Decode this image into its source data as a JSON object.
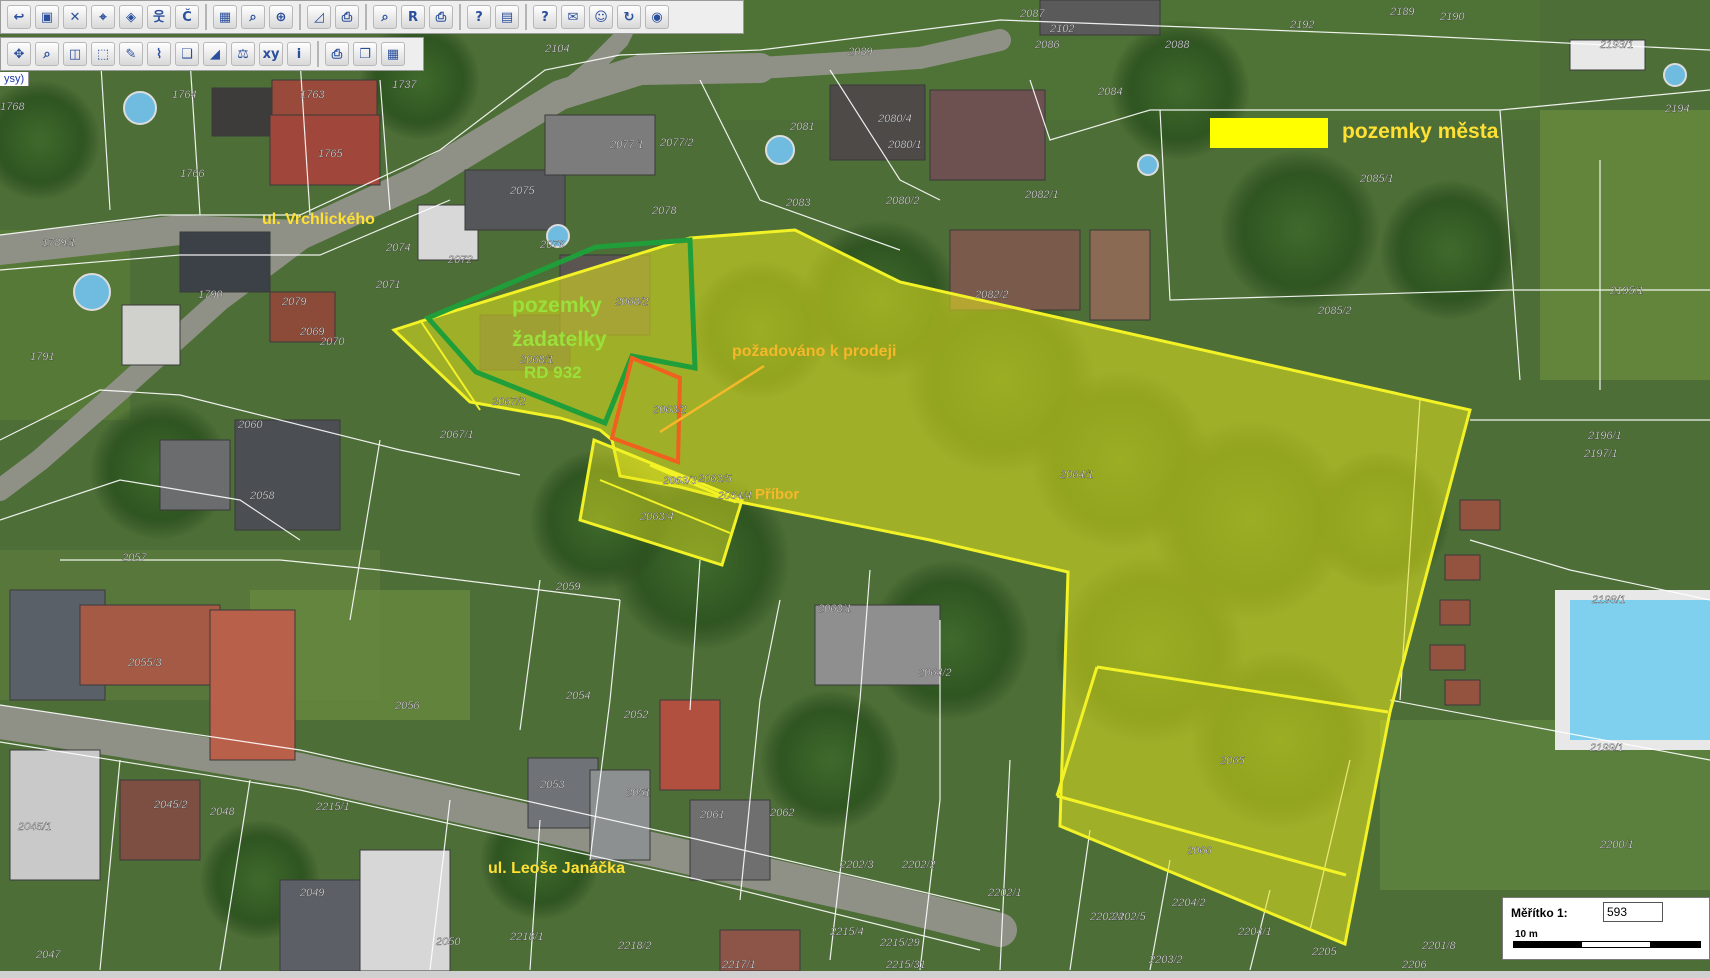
{
  "toolbar_top": [
    {
      "icon": "back-icon",
      "glyph": "↩"
    },
    {
      "icon": "save-icon",
      "glyph": "▣"
    },
    {
      "icon": "delete-map-icon",
      "glyph": "✕"
    },
    {
      "icon": "identify-icon",
      "glyph": "⌖"
    },
    {
      "icon": "pin-icon",
      "glyph": "◈"
    },
    {
      "icon": "person-icon",
      "glyph": "웃"
    },
    {
      "icon": "cadastral-number-icon",
      "glyph": "Č"
    },
    {
      "icon": "parcel-info-icon",
      "glyph": "▦"
    },
    {
      "icon": "zoom-icon",
      "glyph": "⌕"
    },
    {
      "icon": "zoom-plus-icon",
      "glyph": "⊕"
    },
    {
      "icon": "measure-icon",
      "glyph": "◿"
    },
    {
      "icon": "print-icon",
      "glyph": "⎙"
    },
    {
      "icon": "search-icon",
      "glyph": "⌕"
    },
    {
      "icon": "rvo-icon",
      "glyph": "R"
    },
    {
      "icon": "printer-icon",
      "glyph": "⎙"
    },
    {
      "icon": "report-icon",
      "glyph": "?"
    },
    {
      "icon": "document-icon",
      "glyph": "▤"
    },
    {
      "icon": "help-icon",
      "glyph": "?"
    },
    {
      "icon": "mail-icon",
      "glyph": "✉"
    },
    {
      "icon": "user-icon",
      "glyph": "☺"
    },
    {
      "icon": "refresh-icon",
      "glyph": "↻"
    },
    {
      "icon": "globe-icon",
      "glyph": "◉"
    }
  ],
  "toolbar_second": [
    {
      "icon": "navigate-icon",
      "glyph": "✥"
    },
    {
      "icon": "zoom-window-icon",
      "glyph": "⌕"
    },
    {
      "icon": "zoom-select-icon",
      "glyph": "◫"
    },
    {
      "icon": "select-icon",
      "glyph": "⬚"
    },
    {
      "icon": "pencil-icon",
      "glyph": "✎"
    },
    {
      "icon": "edit-node-icon",
      "glyph": "⌇"
    },
    {
      "icon": "layers-icon",
      "glyph": "❑"
    },
    {
      "icon": "eraser-icon",
      "glyph": "◢"
    },
    {
      "icon": "scale-icon",
      "glyph": "⚖"
    },
    {
      "icon": "coordinates-icon",
      "glyph": "xy"
    },
    {
      "icon": "info-icon",
      "glyph": "i"
    },
    {
      "icon": "printer-icon",
      "glyph": "⎙"
    },
    {
      "icon": "copy-icon",
      "glyph": "❐"
    },
    {
      "icon": "legend-icon",
      "glyph": "▦"
    }
  ],
  "layer_tab": "ysy)",
  "legend": {
    "text": "pozemky města",
    "swatch_color": "#ffff00"
  },
  "annotations": {
    "applicant_lots": [
      "pozemky",
      "žadatelky"
    ],
    "house": "RD 932",
    "requested": "požadováno k prodeji",
    "town": "Příbor",
    "street_1": "ul. Vrchlického",
    "street_2": "ul. Leoše Janáčka"
  },
  "colors": {
    "city_outline": "#f2f226",
    "city_fill": "#e6e61e",
    "applicant_outline": "#1f9e3a",
    "requested_outline": "#f0601e",
    "label_yellow": "#ffe033",
    "label_green": "#9ae03a",
    "label_orange": "#f5b82a",
    "parcel_line": "#ffffff"
  },
  "parcel_numbers": [
    "2104",
    "2102",
    "2087",
    "2086",
    "2088",
    "2192",
    "2189",
    "2190",
    "2193/1",
    "1768",
    "1764",
    "1763",
    "1737",
    "2089",
    "2084",
    "2194",
    "1765",
    "1766",
    "2077/1",
    "2077/2",
    "2081",
    "2080/4",
    "2080/1",
    "2075",
    "2083",
    "2080/2",
    "2082/1",
    "2078",
    "2085/1",
    "1789/1",
    "2074",
    "2072",
    "2076",
    "2071",
    "2082/2",
    "1790",
    "2079",
    "2069",
    "2070",
    "2068/2",
    "2085/2",
    "2195/1",
    "1791",
    "2068/1",
    "2067/2",
    "2063/2",
    "2067/1",
    "2060",
    "2058",
    "2063/3",
    "2063/5",
    "2064/4",
    "2063/4",
    "2064/1",
    "2196/1",
    "2197/1",
    "2057",
    "2059",
    "2063/1",
    "2198/1",
    "2055/3",
    "2064/2",
    "2054",
    "2052",
    "2056",
    "2065",
    "2199/1",
    "2053",
    "2051",
    "2061",
    "2062",
    "2045/2",
    "2048",
    "2215/1",
    "2045/1",
    "2066",
    "2200/1",
    "2202/3",
    "2202/2",
    "2049",
    "2202/1",
    "2204/2",
    "2202/4",
    "2202/5",
    "2218/1",
    "2218/2",
    "2215/4",
    "2215/29",
    "2204/1",
    "2203/2",
    "2047",
    "2050",
    "2217/1",
    "2215/31",
    "2205",
    "2206",
    "2201/8"
  ],
  "scale": {
    "label": "Měřítko 1:",
    "value": "593",
    "bar_label": "10 m"
  }
}
